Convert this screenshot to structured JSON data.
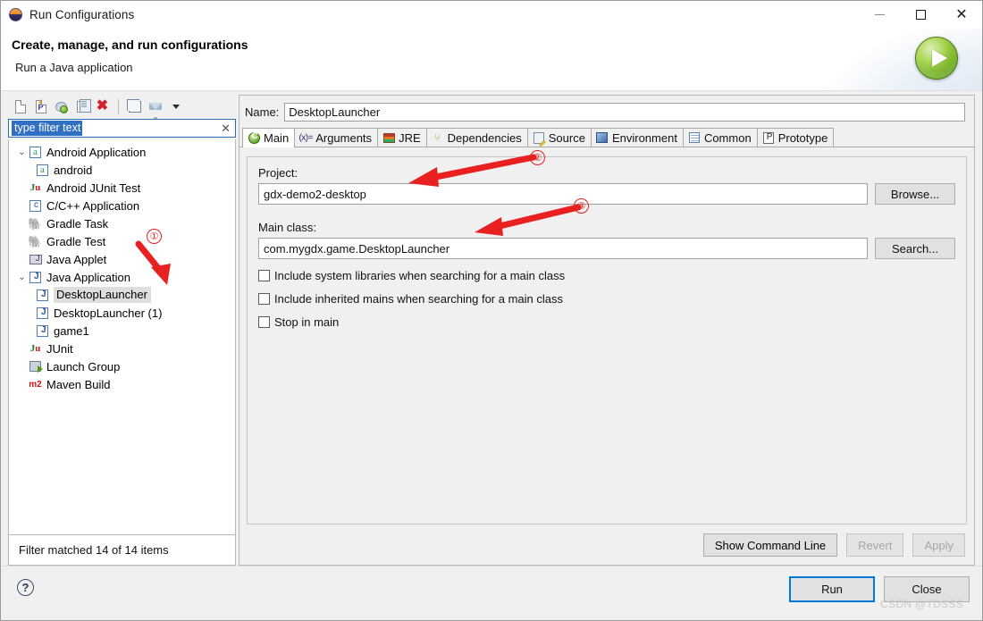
{
  "window": {
    "title": "Run Configurations",
    "icon": "eclipse-icon",
    "controls": {
      "minimize": "minimize-icon",
      "maximize": "maximize-icon",
      "close": "close-icon"
    }
  },
  "header": {
    "title": "Create, manage, and run configurations",
    "subtitle": "Run a Java application",
    "run_icon": "run-play-icon"
  },
  "left": {
    "toolbar": [
      {
        "name": "new-launch-configuration-icon",
        "tooltip": "New launch configuration"
      },
      {
        "name": "new-prototype-icon",
        "tooltip": "New prototype"
      },
      {
        "name": "export-launch-configuration-icon",
        "tooltip": "Export"
      },
      {
        "name": "duplicate-icon",
        "tooltip": "Duplicate"
      },
      {
        "name": "delete-icon",
        "tooltip": "Delete"
      },
      {
        "name": "collapse-all-icon",
        "tooltip": "Collapse All"
      },
      {
        "name": "filter-icon",
        "tooltip": "Filter launch configurations"
      },
      {
        "name": "view-menu-icon",
        "tooltip": "View Menu"
      }
    ],
    "filter": {
      "value": "type filter text",
      "placeholder": "type filter text",
      "clear_icon": "clear-icon"
    },
    "tree": [
      {
        "label": "Android Application",
        "icon": "android-icon",
        "expanded": true,
        "indent": 0,
        "selected": false
      },
      {
        "label": "android",
        "icon": "android-icon",
        "expanded": null,
        "indent": 1,
        "selected": false
      },
      {
        "label": "Android JUnit Test",
        "icon": "junit-android-icon",
        "expanded": null,
        "indent": 0,
        "selected": false
      },
      {
        "label": "C/C++ Application",
        "icon": "cpp-icon",
        "expanded": null,
        "indent": 0,
        "selected": false
      },
      {
        "label": "Gradle Task",
        "icon": "gradle-elephant-icon",
        "expanded": null,
        "indent": 0,
        "selected": false
      },
      {
        "label": "Gradle Test",
        "icon": "gradle-elephant-icon",
        "expanded": null,
        "indent": 0,
        "selected": false
      },
      {
        "label": "Java Applet",
        "icon": "java-applet-icon",
        "expanded": null,
        "indent": 0,
        "selected": false
      },
      {
        "label": "Java Application",
        "icon": "java-application-icon",
        "expanded": true,
        "indent": 0,
        "selected": false
      },
      {
        "label": "DesktopLauncher",
        "icon": "java-application-icon",
        "expanded": null,
        "indent": 1,
        "selected": true
      },
      {
        "label": "DesktopLauncher (1)",
        "icon": "java-application-icon",
        "expanded": null,
        "indent": 1,
        "selected": false
      },
      {
        "label": "game1",
        "icon": "java-application-icon",
        "expanded": null,
        "indent": 1,
        "selected": false
      },
      {
        "label": "JUnit",
        "icon": "junit-icon",
        "expanded": null,
        "indent": 0,
        "selected": false
      },
      {
        "label": "Launch Group",
        "icon": "launch-group-icon",
        "expanded": null,
        "indent": 0,
        "selected": false
      },
      {
        "label": "Maven Build",
        "icon": "maven-icon",
        "expanded": null,
        "indent": 0,
        "selected": false
      }
    ],
    "status": "Filter matched 14 of 14 items"
  },
  "right": {
    "name_label": "Name:",
    "name_value": "DesktopLauncher",
    "tabs": [
      {
        "label": "Main",
        "icon": "main-tab-icon",
        "active": true
      },
      {
        "label": "Arguments",
        "icon": "arguments-tab-icon",
        "active": false
      },
      {
        "label": "JRE",
        "icon": "jre-tab-icon",
        "active": false
      },
      {
        "label": "Dependencies",
        "icon": "dependencies-tab-icon",
        "active": false
      },
      {
        "label": "Source",
        "icon": "source-tab-icon",
        "active": false
      },
      {
        "label": "Environment",
        "icon": "environment-tab-icon",
        "active": false
      },
      {
        "label": "Common",
        "icon": "common-tab-icon",
        "active": false
      },
      {
        "label": "Prototype",
        "icon": "prototype-tab-icon",
        "active": false
      }
    ],
    "main_tab": {
      "project_label": "Project:",
      "project_value": "gdx-demo2-desktop",
      "browse_label": "Browse...",
      "main_class_label": "Main class:",
      "main_class_value": "com.mygdx.game.DesktopLauncher",
      "search_label": "Search...",
      "checkboxes": [
        {
          "label": "Include system libraries when searching for a main class",
          "checked": false
        },
        {
          "label": "Include inherited mains when searching for a main class",
          "checked": false
        },
        {
          "label": "Stop in main",
          "checked": false
        }
      ]
    },
    "footer": {
      "show_command_line": "Show Command Line",
      "revert": "Revert",
      "apply": "Apply"
    }
  },
  "dialog_footer": {
    "help_icon": "help-icon",
    "run_label": "Run",
    "close_label": "Close",
    "watermark": "CSDN @TDSSS"
  },
  "annotations": [
    {
      "id": "1",
      "label": "①"
    },
    {
      "id": "2",
      "label": "②"
    },
    {
      "id": "3",
      "label": "③"
    }
  ],
  "colors": {
    "accent": "#0078d7",
    "annotation_red": "#e8201f",
    "selection_blue": "#2f6fc4",
    "run_green": "#63a515"
  }
}
